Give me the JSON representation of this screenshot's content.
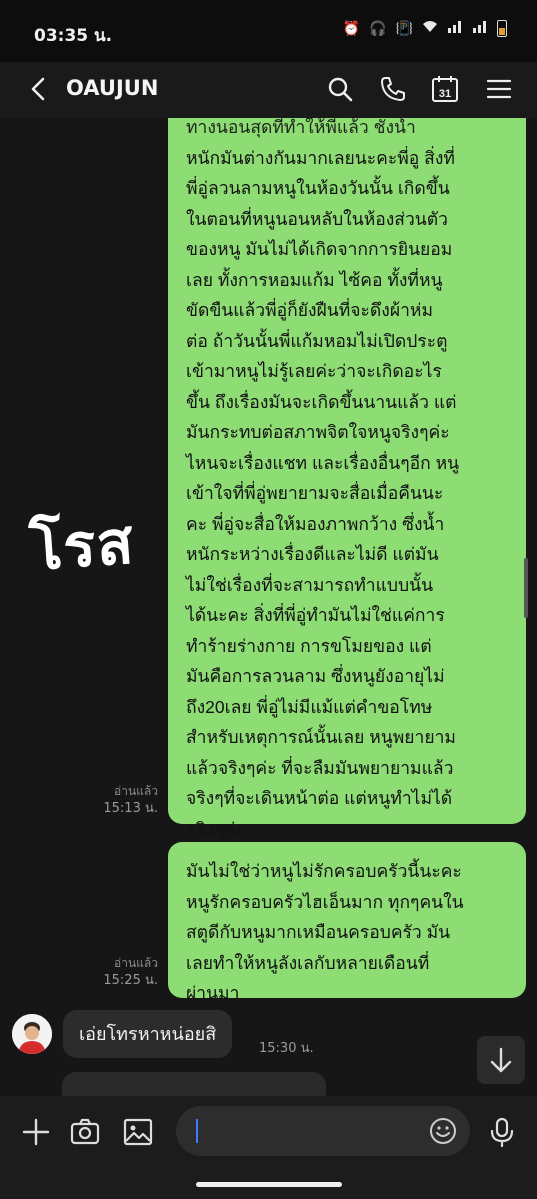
{
  "status_bar": {
    "time": "03:35 น."
  },
  "header": {
    "title": "OAUJUN",
    "calendar_day": "31"
  },
  "watermark": "โรส",
  "messages": [
    {
      "direction": "out",
      "lines": [
        "ทางนอนสุดที่ทำให้พี่แล้ว ชั่งน้ำ",
        "หนักมันต่างกันมากเลยนะคะพี่อู สิ่งที่",
        "พี่อู่ลวนลามหนูในห้องวันนั้น เกิดขึ้น",
        "ในตอนที่หนูนอนหลับในห้องส่วนตัว",
        "ของหนู มันไม่ได้เกิดจากการยินยอม",
        "เลย ทั้งการหอมแก้ม ไซ้คอ ทั้งที่หนู",
        "ขัดขืนแล้วพี่อู่ก็ยังฝืนที่จะดึงผ้าห่ม",
        "ต่อ ถ้าวันนั้นพี่แก้มหอมไม่เปิดประตู",
        "เข้ามาหนูไม่รู้เลยค่ะว่าจะเกิดอะไร",
        "ขึ้น ถึงเรื่องมันจะเกิดขึ้นนานแล้ว แต่",
        "มันกระทบต่อสภาพจิตใจหนูจริงๆค่ะ",
        "ไหนจะเรื่องแชท และเรื่องอื่นๆอีก หนู",
        "เข้าใจที่พี่อู่พยายามจะสื่อเมื่อคืนนะ",
        "คะ พี่อู่จะสื่อให้มองภาพกว้าง ซึ่งน้ำ",
        "หนักระหว่างเรื่องดีและไม่ดี แต่มัน",
        "ไม่ใช่เรื่องที่จะสามารถทำแบบนั้น",
        "ได้นะคะ สิ่งที่พี่อู่ทำมันไม่ใช่แค่การ",
        "ทำร้ายร่างกาย การขโมยของ แต่",
        "มันคือการลวนลาม ซึ่งหนูยังอายุไม่",
        "ถึง20เลย พี่อู่ไม่มีแม้แต่คำขอโทษ",
        "สำหรับเหตุการณ์นั้นเลย หนูพยายาม",
        "แล้วจริงๆค่ะ ที่จะลืมมันพยายามแล้ว",
        "จริงๆที่จะเดินหน้าต่อ แต่หนูทำไม่ได้",
        "จริงๆค่ะ"
      ],
      "read_label": "อ่านแล้ว",
      "time": "15:13 น."
    },
    {
      "direction": "out",
      "lines": [
        "มันไม่ใช่ว่าหนูไม่รักครอบครัวนี้นะคะ",
        "หนูรักครอบครัวไฮเอ็นมาก ทุกๆคนใน",
        "สตูดีกับหนูมากเหมือนครอบครัว มัน",
        "เลยทำให้หนูลังเลกับหลายเดือนที่",
        "ผ่านมา"
      ],
      "read_label": "อ่านแล้ว",
      "time": "15:25 น."
    },
    {
      "direction": "in",
      "text": "เอ่ยโทรหาหน่อยสิ",
      "time": "15:30 น."
    }
  ],
  "input": {
    "placeholder": ""
  },
  "colors": {
    "bubble_out": "#8ddc74",
    "bubble_in": "#2c2c2c",
    "background": "#161616"
  }
}
